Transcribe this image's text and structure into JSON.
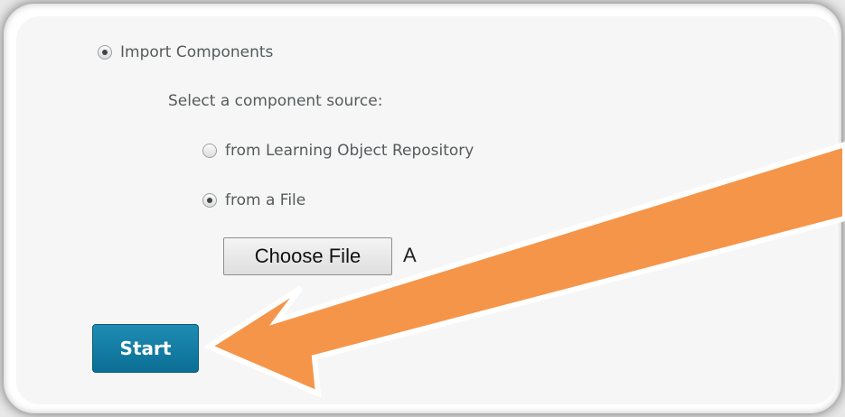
{
  "form": {
    "import_option_label": "Import Components",
    "source_prompt": "Select a component source:",
    "source_lor_label": "from Learning Object Repository",
    "source_file_label": "from a File",
    "choose_file_label": "Choose File",
    "file_status_visible": "A",
    "start_label": "Start"
  },
  "selection": {
    "import_components": true,
    "from_lor": false,
    "from_file": true
  },
  "colors": {
    "start_button": "#1081aa",
    "arrow_fill": "#f5954a",
    "arrow_outline": "#ffffff"
  },
  "icons": {
    "annotation": "pointer-arrow-icon"
  }
}
